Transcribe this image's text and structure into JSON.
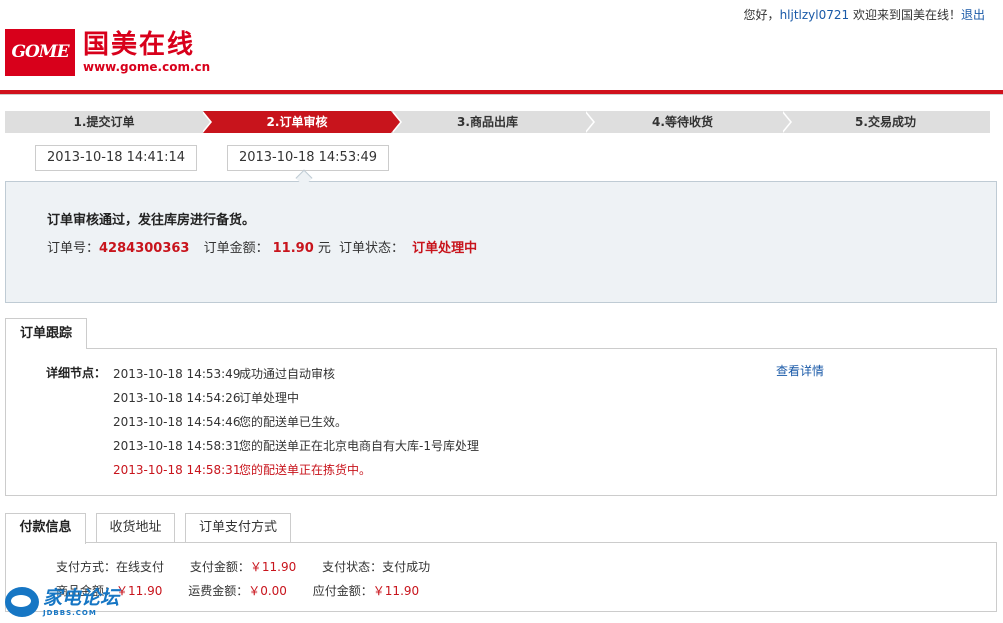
{
  "header": {
    "greeting": "您好，",
    "username": "hljtlzyl0721",
    "welcome": " 欢迎来到国美在线！",
    "logout": "退出"
  },
  "logo": {
    "mark": "GOME",
    "name_cn": "国美在线",
    "url": "www.gome.com.cn",
    "brand_color": "#d8001b"
  },
  "steps": [
    {
      "label": "1.提交订单",
      "active": false
    },
    {
      "label": "2.订单审核",
      "active": true
    },
    {
      "label": "3.商品出库",
      "active": false
    },
    {
      "label": "4.等待收货",
      "active": false
    },
    {
      "label": "5.交易成功",
      "active": false
    }
  ],
  "timestamps": [
    "2013-10-18 14:41:14",
    "2013-10-18 14:53:49"
  ],
  "status": {
    "title": "订单审核通过，发往库房进行备货。",
    "order_no_label": "订单号：",
    "order_no": "4284300363",
    "amount_label": "订单金额：",
    "amount": "11.90",
    "amount_unit": " 元",
    "state_label": "订单状态：",
    "state": "订单处理中"
  },
  "tracking": {
    "tab_label": "订单跟踪",
    "detail_label": "详细节点：",
    "view_detail": "查看详情",
    "rows": [
      {
        "time": "2013-10-18 14:53:49",
        "text": "成功通过自动审核"
      },
      {
        "time": "2013-10-18 14:54:26",
        "text": "订单处理中"
      },
      {
        "time": "2013-10-18 14:54:46",
        "text": "您的配送单已生效。"
      },
      {
        "time": "2013-10-18 14:58:31",
        "text": "您的配送单正在北京电商自有大库-1号库处理"
      },
      {
        "time": "2013-10-18 14:58:31",
        "text": "您的配送单正在拣货中。"
      }
    ]
  },
  "payment": {
    "tabs": [
      "付款信息",
      "收货地址",
      "订单支付方式"
    ],
    "line1": [
      {
        "label": "支付方式：",
        "value": "在线支付",
        "money": false
      },
      {
        "label": "支付金额：",
        "value": "￥11.90",
        "money": true
      },
      {
        "label": "支付状态：",
        "value": "支付成功",
        "money": false
      }
    ],
    "line2": [
      {
        "label": "商品金额：",
        "value": "￥11.90",
        "money": true
      },
      {
        "label": "运费金额：",
        "value": "￥0.00",
        "money": true
      },
      {
        "label": "应付金额：",
        "value": "￥11.90",
        "money": true
      }
    ]
  },
  "watermark": {
    "name_cn": "家电论坛",
    "url": "JDBBS.COM"
  },
  "colors": {
    "accent_red": "#c8141c",
    "link_blue": "#1a5aa8",
    "panel_bg": "#eef2f5"
  }
}
